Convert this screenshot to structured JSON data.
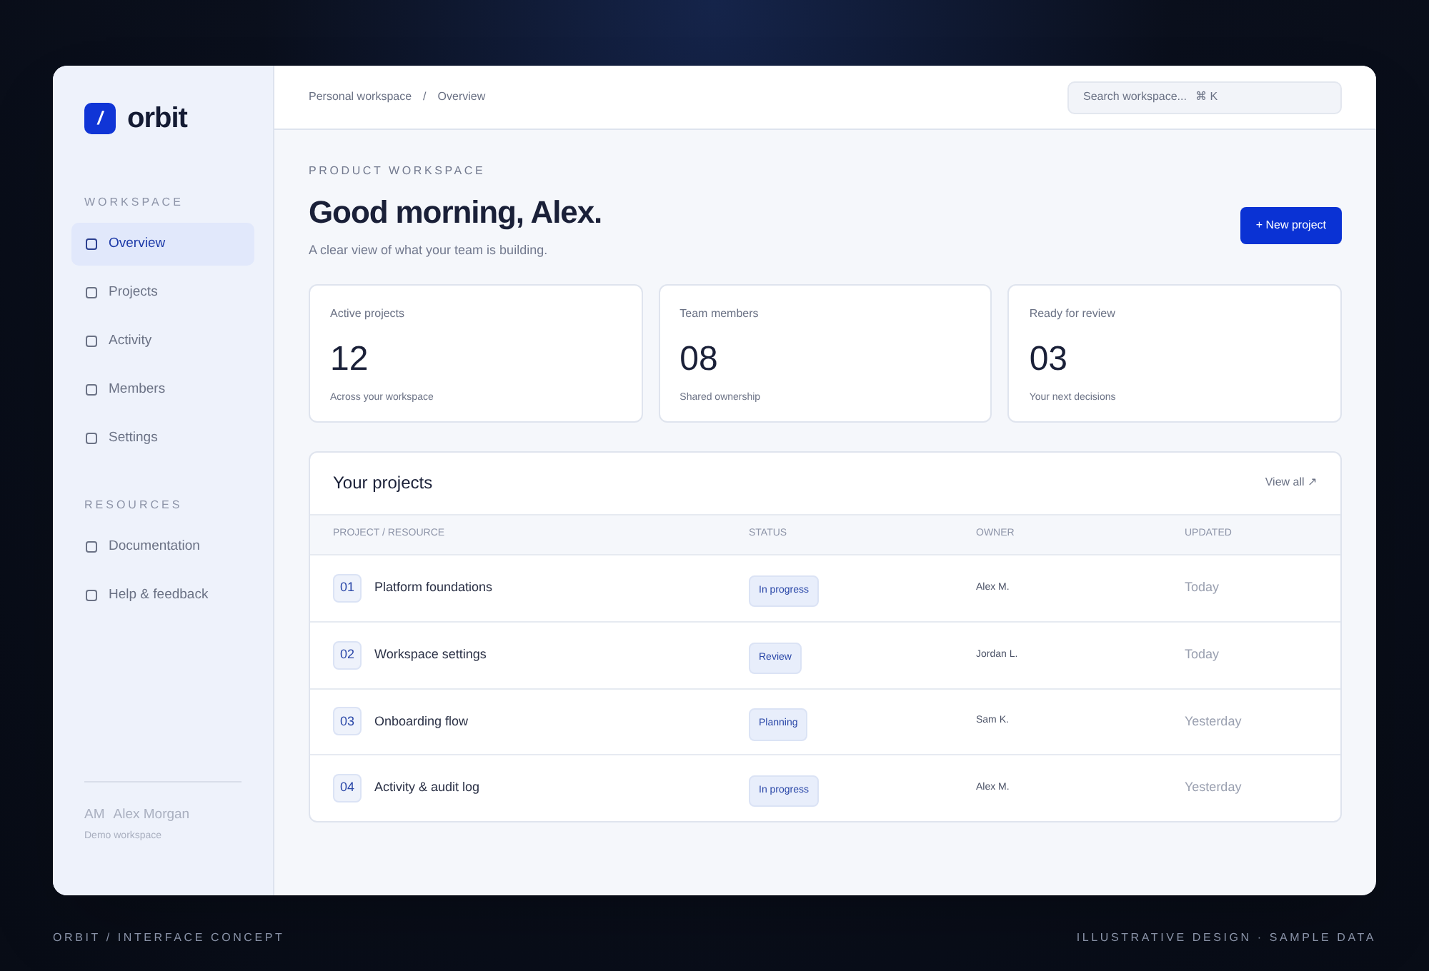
{
  "brand": {
    "mark": "/",
    "name": "orbit"
  },
  "sidebar": {
    "sections": [
      {
        "title": "WORKSPACE",
        "items": [
          {
            "label": "Overview",
            "selected": true
          },
          {
            "label": "Projects",
            "selected": false
          },
          {
            "label": "Activity",
            "selected": false
          },
          {
            "label": "Members",
            "selected": false
          },
          {
            "label": "Settings",
            "selected": false
          }
        ]
      },
      {
        "title": "RESOURCES",
        "items": [
          {
            "label": "Documentation",
            "selected": false
          },
          {
            "label": "Help & feedback",
            "selected": false
          }
        ]
      }
    ],
    "user": {
      "initials": "AM",
      "name": "Alex Morgan",
      "workspace": "Demo workspace"
    }
  },
  "breadcrumb": [
    "Personal workspace",
    "/",
    "Overview"
  ],
  "search": {
    "placeholder": "Search workspace...",
    "shortcut": "⌘ K"
  },
  "eyebrow": "PRODUCT WORKSPACE",
  "heading": "Good morning, Alex.",
  "subheading": "A clear view of what your team is building.",
  "new_button": "+ New project",
  "stats": [
    {
      "label": "Active projects",
      "value": "12",
      "note": "Across your workspace"
    },
    {
      "label": "Team members",
      "value": "08",
      "note": "Shared ownership"
    },
    {
      "label": "Ready for review",
      "value": "03",
      "note": "Your next decisions"
    }
  ],
  "projects": {
    "title": "Your projects",
    "view_all": "View all ↗",
    "columns": [
      "PROJECT / RESOURCE",
      "STATUS",
      "OWNER",
      "UPDATED"
    ],
    "rows": [
      {
        "number": "01",
        "name": "Platform foundations",
        "status": "In progress",
        "owner": "Alex M.",
        "updated": "Today"
      },
      {
        "number": "02",
        "name": "Workspace settings",
        "status": "Review",
        "owner": "Jordan L.",
        "updated": "Today"
      },
      {
        "number": "03",
        "name": "Onboarding flow",
        "status": "Planning",
        "owner": "Sam K.",
        "updated": "Yesterday"
      },
      {
        "number": "04",
        "name": "Activity & audit log",
        "status": "In progress",
        "owner": "Alex M.",
        "updated": "Yesterday"
      }
    ]
  },
  "footer": {
    "left": "ORBIT / INTERFACE CONCEPT",
    "right": "ILLUSTRATIVE DESIGN · SAMPLE DATA"
  }
}
